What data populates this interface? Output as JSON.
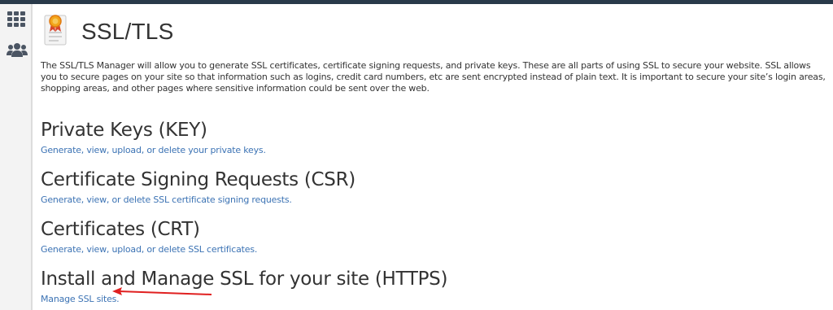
{
  "sidebar": {
    "items": [
      {
        "icon": "grid-icon"
      },
      {
        "icon": "users-icon"
      }
    ]
  },
  "header": {
    "title": "SSL/TLS",
    "icon": "certificate-icon"
  },
  "description": "The SSL/TLS Manager will allow you to generate SSL certificates, certificate signing requests, and private keys. These are all parts of using SSL to secure your website. SSL allows you to secure pages on your site so that information such as logins, credit card numbers, etc are sent encrypted instead of plain text. It is important to secure your site’s login areas, shopping areas, and other pages where sensitive information could be sent over the web.",
  "sections": [
    {
      "heading": "Private Keys (KEY)",
      "link": "Generate, view, upload, or delete your private keys."
    },
    {
      "heading": "Certificate Signing Requests (CSR)",
      "link": "Generate, view, or delete SSL certificate signing requests."
    },
    {
      "heading": "Certificates (CRT)",
      "link": "Generate, view, upload, or delete SSL certificates."
    },
    {
      "heading": "Install and Manage SSL for your site (HTTPS)",
      "link": "Manage SSL sites."
    }
  ],
  "annotation": {
    "color": "#e02020"
  }
}
